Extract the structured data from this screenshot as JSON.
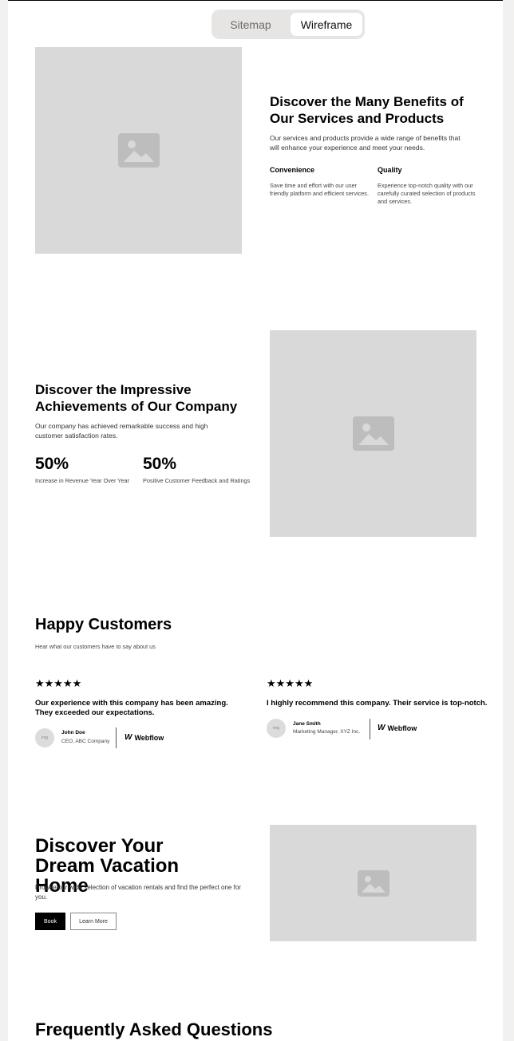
{
  "toggle": {
    "sitemap": "Sitemap",
    "wireframe": "Wireframe"
  },
  "benefits": {
    "title": "Discover the Many Benefits of Our Services and Products",
    "desc": "Our services and products provide a wide range of benefits that will enhance your experience and meet your needs.",
    "features": [
      {
        "title": "Convenience",
        "text": "Save time and effort with our user friendly platform and efficient services."
      },
      {
        "title": "Quality",
        "text": "Experience top-notch quality with our carefully curated selection of products and services."
      }
    ]
  },
  "achievements": {
    "title": "Discover the Impressive Achievements of Our Company",
    "desc": "Our company has achieved remarkable success and high customer satisfaction rates.",
    "stats": [
      {
        "value": "50%",
        "label": "Increase in Revenue Year Over Year"
      },
      {
        "value": "50%",
        "label": "Positive Customer Feedback and Ratings"
      }
    ]
  },
  "testimonials": {
    "title": "Happy Customers",
    "subtitle": "Hear what our customers have to say about us",
    "items": [
      {
        "stars": "★★★★★",
        "quote": "Our experience with this company has been amazing. They exceeded our expectations.",
        "name": "John Doe",
        "role": "CEO, ABC Company",
        "logo": "Webflow"
      },
      {
        "stars": "★★★★★",
        "quote": "I highly recommend this company. Their service is top-notch.",
        "name": "Jane Smith",
        "role": "Marketing Manager, XYZ Inc.",
        "logo": "Webflow"
      }
    ]
  },
  "vacation": {
    "title": "Discover Your Dream Vacation Home",
    "desc": "Browse our wide selection of vacation rentals and find the perfect one for you.",
    "primary": "Book",
    "secondary": "Learn More"
  },
  "faq": {
    "title": "Frequently Asked Questions"
  },
  "colors": {
    "placeholder": "#d9d9d9",
    "accent": "#000000",
    "background": "#f2f1ef"
  }
}
